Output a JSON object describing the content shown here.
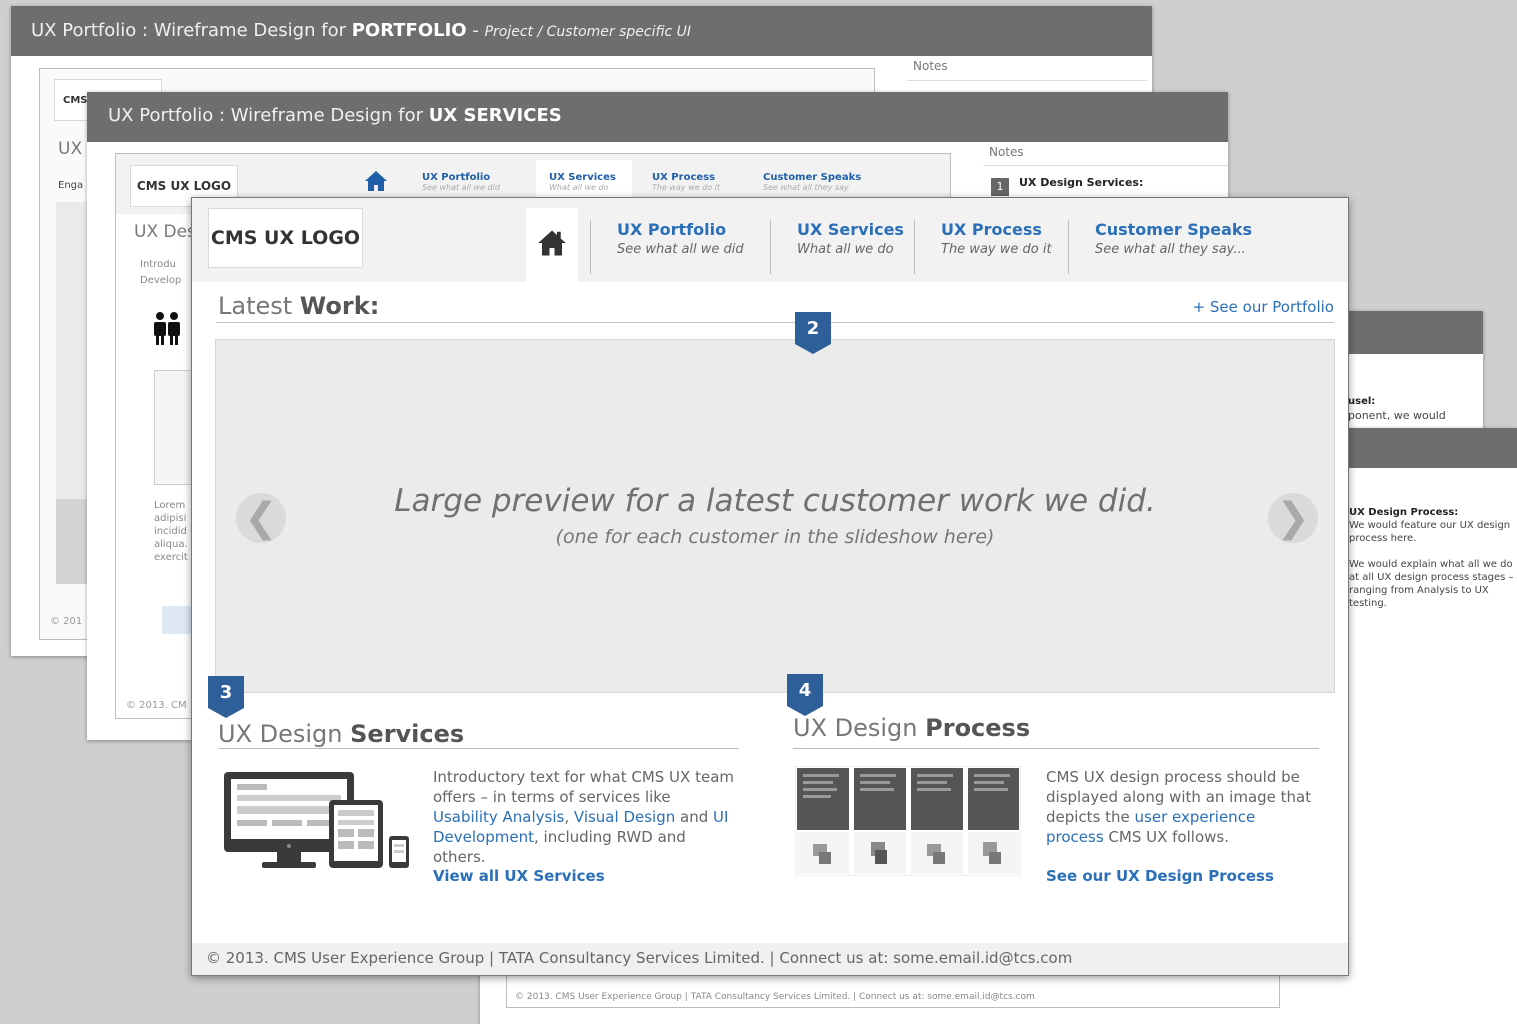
{
  "sheet1": {
    "title_prefix": "UX Portfolio : Wireframe Design for ",
    "title_bold": "PORTFOLIO",
    "title_sep": " - ",
    "title_italic": "Project / Customer specific UI",
    "notes_label": "Notes",
    "logo_fragment": "CMS",
    "heading_fragment": "UX",
    "text_fragment": "Enga",
    "copyright_fragment": "© 201"
  },
  "sheet2": {
    "title_prefix": "UX Portfolio : Wireframe Design for ",
    "title_bold": "UX SERVICES",
    "logo": "CMS UX LOGO",
    "nav": [
      {
        "title": "UX Portfolio",
        "sub": "See what all we did"
      },
      {
        "title": "UX Services",
        "sub": "What all we do"
      },
      {
        "title": "UX Process",
        "sub": "The way we do it"
      },
      {
        "title": "Customer Speaks",
        "sub": "See what all they say"
      }
    ],
    "heading_fragment": "UX Des",
    "intro_fragment_1": "Introdu",
    "intro_fragment_2": "Develop",
    "lorem_lines": [
      "Lorem",
      "adipisi",
      "incidid",
      "aliqua.",
      "exercit"
    ],
    "notes_label": "Notes",
    "note_number": "1",
    "note_title": "UX Design Services:",
    "copyright_fragment": "© 2013. CM"
  },
  "sheet3": {
    "note_title_fragment": "usel:",
    "note_text_fragment": "ponent, we would"
  },
  "sheet4": {
    "note_title": "UX Design Process:",
    "note_lines": [
      "We would feature our UX design",
      "process here.",
      "",
      "We would explain what all we do",
      "at all UX design process stages –",
      "ranging from Analysis to UX",
      "testing."
    ],
    "footer": "© 2013. CMS User Experience Group | TATA Consultancy Services Limited.  |  Connect us at:  some.email.id@tcs.com"
  },
  "front": {
    "logo": "CMS UX LOGO",
    "nav": [
      {
        "title": "UX Portfolio",
        "sub": "See what all we did"
      },
      {
        "title": "UX Services",
        "sub": "What all we do"
      },
      {
        "title": "UX Process",
        "sub": "The way we do it"
      },
      {
        "title": "Customer Speaks",
        "sub": "See what all they say..."
      }
    ],
    "latest_prefix": "Latest ",
    "latest_bold": "Work:",
    "see_portfolio": "+ See our Portfolio",
    "marker_2": "2",
    "preview_main": "Large preview for a latest customer work we did.",
    "preview_sub": "(one for each customer in the slideshow here)",
    "prev_arrow": "❮",
    "next_arrow": "❯",
    "services": {
      "marker": "3",
      "title_prefix": "UX Design ",
      "title_bold": "Services",
      "text_1": "Introductory text for what CMS UX team offers – in terms of services like ",
      "link_1": "Usability Analysis",
      "text_2": ", ",
      "link_2": "Visual Design",
      "text_3": " and ",
      "link_3": "UI Development",
      "text_4": ", including RWD and others.",
      "link": "View all UX Services"
    },
    "process": {
      "marker": "4",
      "title_prefix": "UX Design ",
      "title_bold": "Process",
      "text_1": "CMS UX design process should be displayed along with an image that depicts the ",
      "link_1": "user experience process",
      "text_2": " CMS UX follows.",
      "link": "See our UX Design Process"
    },
    "footer": "© 2013. CMS User Experience Group | TATA Consultancy Services Limited.  |  Connect us at:  some.email.id@tcs.com"
  },
  "colors": {
    "accent": "#2a6fb8",
    "marker": "#2f5f98",
    "titlebar": "#6e6e6e"
  }
}
